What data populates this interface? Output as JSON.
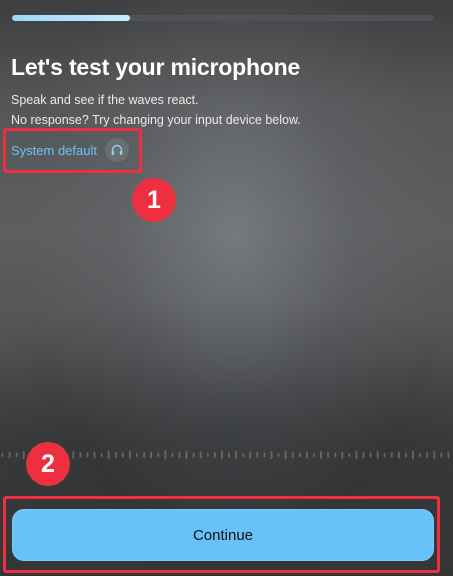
{
  "onboarding": {
    "progress_fraction": 0.28,
    "title": "Let's test your microphone",
    "instructions": [
      "Speak and see if the waves react.",
      "No response? Try changing your input device below."
    ],
    "input_device": {
      "label": "System default",
      "icon": "headphones-icon"
    },
    "continue_label": "Continue"
  },
  "annotations": [
    {
      "label": "1"
    },
    {
      "label": "2"
    }
  ],
  "colors": {
    "accent": "#67c2f9",
    "link": "#6bc4f7",
    "annotation": "#ee2f3f",
    "background": "#555759"
  }
}
